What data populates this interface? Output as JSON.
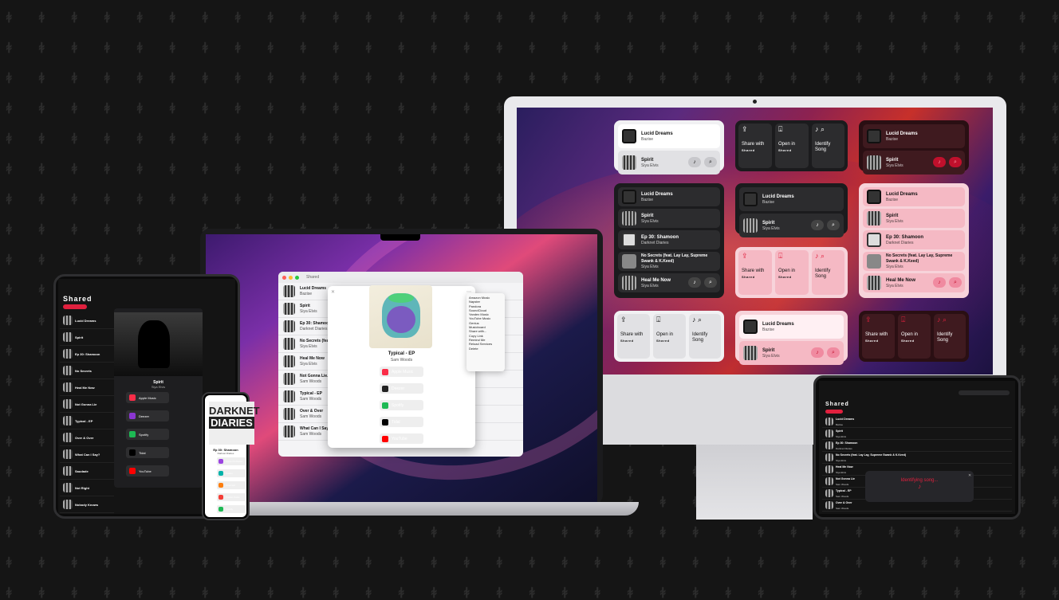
{
  "brand": {
    "name": "Shared",
    "accent": "#e0203e"
  },
  "widgets": {
    "row1": {
      "light_small": {
        "items": [
          {
            "title": "Lucid Dreams",
            "artist": "Bazise"
          },
          {
            "title": "Spirit",
            "artist": "Siya Elvis"
          }
        ]
      },
      "actions_dark": {
        "share": "Share with",
        "share_brand": "Shared",
        "open": "Open in",
        "open_brand": "Shared",
        "identify": "Identify",
        "identify2": "Song"
      },
      "red_small": {
        "items": [
          {
            "title": "Lucid Dreams",
            "artist": "Bazise"
          },
          {
            "title": "Spirit",
            "artist": "Siya Elvis"
          }
        ]
      }
    },
    "row2": {
      "dark_large": {
        "items": [
          {
            "title": "Lucid Dreams",
            "artist": "Bazise"
          },
          {
            "title": "Spirit",
            "artist": "Siya Elvis"
          },
          {
            "title": "Ep 30: Shamoon",
            "artist": "Darknet Diaries"
          },
          {
            "title": "No Secrets (feat. Lay Lay, Supreme Swank & K.Keed)",
            "artist": "Siya Elvis"
          },
          {
            "title": "Heal Me Now",
            "artist": "Siya Elvis"
          }
        ]
      },
      "dark_small": {
        "items": [
          {
            "title": "Lucid Dreams",
            "artist": "Bazise"
          },
          {
            "title": "Spirit",
            "artist": "Siya Elvis"
          }
        ]
      },
      "pink_large": {
        "items": [
          {
            "title": "Lucid Dreams",
            "artist": "Bazise"
          },
          {
            "title": "Spirit",
            "artist": "Siya Elvis"
          },
          {
            "title": "Ep 30: Shamoon",
            "artist": "Darknet Diaries"
          },
          {
            "title": "No Secrets (feat. Lay Lay, Supreme Swank & K.Keed)",
            "artist": "Siya Elvis"
          },
          {
            "title": "Heal Me Now",
            "artist": "Siya Elvis"
          }
        ]
      },
      "pink_actions": {
        "share": "Share with",
        "share_brand": "Shared",
        "open": "Open in",
        "open_brand": "Shared",
        "identify": "Identify",
        "identify2": "Song"
      }
    },
    "row3": {
      "light_actions": {
        "share": "Share with",
        "share_brand": "Shared",
        "open": "Open in",
        "open_brand": "Shared",
        "identify": "Identify",
        "identify2": "Song"
      },
      "pink_small": {
        "items": [
          {
            "title": "Lucid Dreams",
            "artist": "Bazise"
          },
          {
            "title": "Spirit",
            "artist": "Siya Elvis"
          }
        ]
      },
      "red_actions": {
        "share": "Share with",
        "share_brand": "Shared",
        "open": "Open in",
        "open_brand": "Shared",
        "identify": "Identify",
        "identify2": "Song"
      }
    }
  },
  "mac_app": {
    "title": "Shared",
    "list": [
      {
        "title": "Lucid Dreams",
        "artist": "Bazise"
      },
      {
        "title": "Spirit",
        "artist": "Siya Elvis"
      },
      {
        "title": "Ep 30: Shamoon",
        "artist": "Darknet Diaries"
      },
      {
        "title": "No Secrets (feat...",
        "artist": "Siya Elvis"
      },
      {
        "title": "Heal Me Now",
        "artist": "Siya Elvis"
      },
      {
        "title": "Not Gonna Lie...",
        "artist": "Sam Woods"
      },
      {
        "title": "Typical - EP",
        "artist": "Sam Woods"
      },
      {
        "title": "Over & Over",
        "artist": "Sam Woods"
      },
      {
        "title": "What Can I Say?",
        "artist": "Sam Woods"
      }
    ],
    "modal": {
      "album": "Typical - EP",
      "artist": "Sam Woods",
      "services": [
        "Apple Music",
        "Deezer",
        "Spotify",
        "Tidal",
        "YouTube"
      ]
    },
    "menu": [
      "Amazon Music",
      "Napster",
      "Pandora",
      "SoundCloud",
      "Yandex Music",
      "YouTube Music",
      "Genius",
      "Musicboard",
      "Share with...",
      "Copy Link",
      "Remind Me",
      "Reload Services",
      "Delete"
    ]
  },
  "ipad_left": {
    "title": "Shared",
    "song": "Spirit",
    "artist": "Siya Elvis",
    "services": [
      "Apple Music",
      "Deezer",
      "Spotify",
      "Tidal",
      "YouTube"
    ],
    "list": [
      "Lucid Dreams",
      "Spirit",
      "Ep 30: Shamoon",
      "No Secrets",
      "Heal Me Now",
      "Not Gonna Lie",
      "Typical - EP",
      "Over & Over",
      "What Can I Say?",
      "Saudade",
      "Not Right",
      "Nobody Knows",
      "Emotion",
      "Go Home",
      "Good Times"
    ]
  },
  "iphone": {
    "cover_l1": "DARKNET",
    "cover_l2": "DIARIES",
    "episode": "Ep 30: Shamoon",
    "show": "Darknet Diaries",
    "services": [
      "Apple Podcasts",
      "Castro",
      "Overcast",
      "Pocket Casts",
      "Spotify"
    ]
  },
  "ipad_right": {
    "title": "Shared",
    "list": [
      {
        "title": "Lucid Dreams",
        "artist": "Bazise"
      },
      {
        "title": "Spirit",
        "artist": "Siya Elvis"
      },
      {
        "title": "Ep 30: Shamoon",
        "artist": "Darknet Diaries"
      },
      {
        "title": "No Secrets (feat. Lay Lay, Supreme Swank & K.Keed)",
        "artist": "Siya Elvis"
      },
      {
        "title": "Heal Me Now",
        "artist": "Siya Elvis"
      },
      {
        "title": "Not Gonna Lie",
        "artist": "Sam Woods"
      },
      {
        "title": "Typical - EP",
        "artist": "Sam Woods"
      },
      {
        "title": "Over & Over",
        "artist": "Sam Woods"
      }
    ],
    "identify_text": "Identifying song..."
  }
}
